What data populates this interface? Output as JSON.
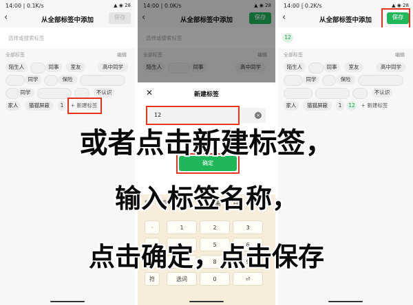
{
  "panel1": {
    "status_left": "14:00 | 0.1K/s",
    "status_right": "▲ ◉ 28",
    "title": "从全部标签中添加",
    "save": "保存",
    "search_placeholder": "选择或搜索标签",
    "section_label": "全部标签",
    "edit": "编辑",
    "tags": [
      "陌生人",
      "同事",
      "室友",
      "高中同学",
      "同学",
      "保险",
      "同学",
      "不认识",
      "家人",
      "猫猫屏蔽",
      "1"
    ],
    "new_tag": "+ 新建标签"
  },
  "panel2": {
    "status_left": "14:00 | 0.0K/s",
    "status_right": "▲ ◉ 28",
    "title": "从全部标签中添加",
    "save": "保存",
    "search_placeholder": "选择或搜索标签",
    "section_label": "全部标签",
    "edit": "编辑",
    "tags": [
      "陌生人",
      "同事",
      "高中同学"
    ],
    "sheet_title": "新建标签",
    "close": "✕",
    "input_value": "12",
    "confirm": "确定",
    "candidates": [
      "的",
      "号",
      "后",
      "点",
      "离",
      "月"
    ],
    "keys": [
      "1",
      "2",
      "3",
      "4",
      "5",
      "6",
      "7",
      "8",
      "9",
      "0",
      "符",
      "选词"
    ]
  },
  "panel3": {
    "status_left": "14:00 | 0.2K/s",
    "status_right": "▲ ◉ 28",
    "title": "从全部标签中添加",
    "save": "保存",
    "selected_tag": "12",
    "section_label": "全部标签",
    "edit": "编辑",
    "tags": [
      "陌生人",
      "同事",
      "室友",
      "高中同学",
      "同学",
      "保险",
      "不认识",
      "家人",
      "猫猫屏蔽",
      "1",
      "12"
    ],
    "new_tag": "+ 新建标签"
  },
  "captions": {
    "line1": "或者点击新建标签，",
    "line2": "输入标签名称，",
    "line3": "点击确定，点击保存"
  },
  "colors": {
    "accent": "#1fb75a",
    "highlight": "#e8321c"
  }
}
